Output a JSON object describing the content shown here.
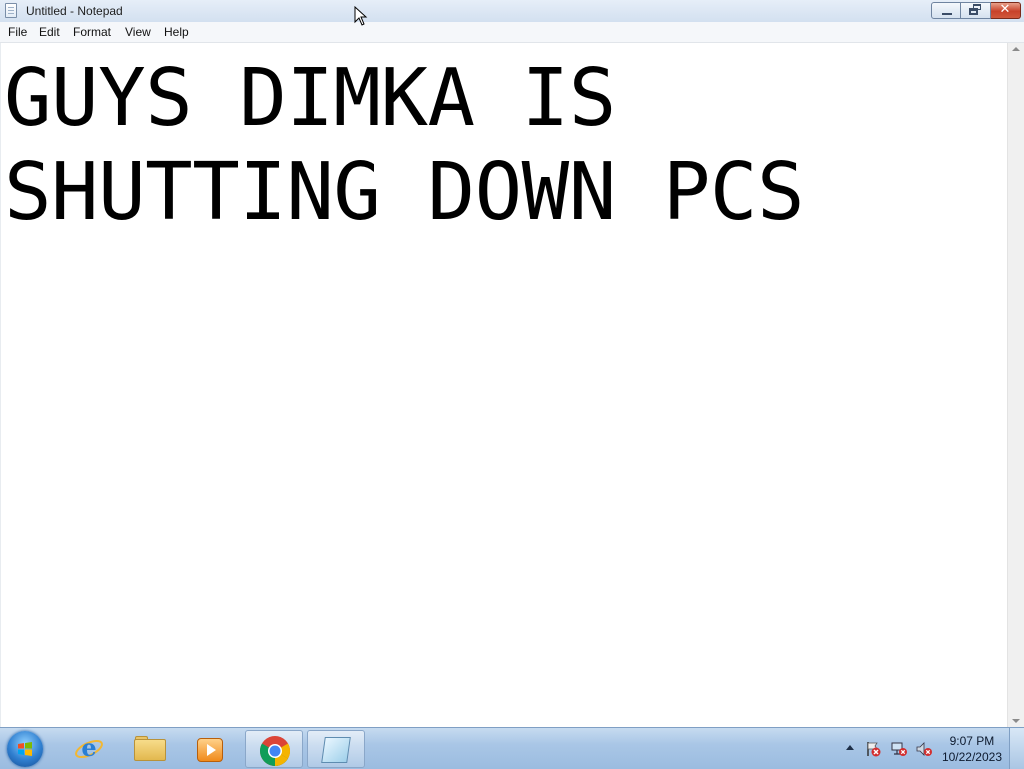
{
  "window": {
    "title": "Untitled - Notepad",
    "close_glyph": "✕"
  },
  "menu": {
    "items": [
      "File",
      "Edit",
      "Format",
      "View",
      "Help"
    ]
  },
  "editor": {
    "content": "GUYS DIMKA IS SHUTTING DOWN PCS"
  },
  "taskbar": {
    "pinned": [
      {
        "name": "internet-explorer-icon"
      },
      {
        "name": "windows-explorer-icon"
      },
      {
        "name": "media-player-icon"
      },
      {
        "name": "chrome-icon"
      },
      {
        "name": "notepad-icon",
        "active": true
      }
    ],
    "tray_icons": [
      "show-hidden-icons-arrow",
      "action-center-error-icon",
      "network-error-icon",
      "volume-muted-icon"
    ],
    "clock": {
      "time": "9:07 PM",
      "date": "10/22/2023"
    }
  },
  "colors": {
    "titlebar": "#dbe6f4",
    "close_button": "#c8422a",
    "taskbar": "#a9c6e6",
    "text": "#000000"
  }
}
